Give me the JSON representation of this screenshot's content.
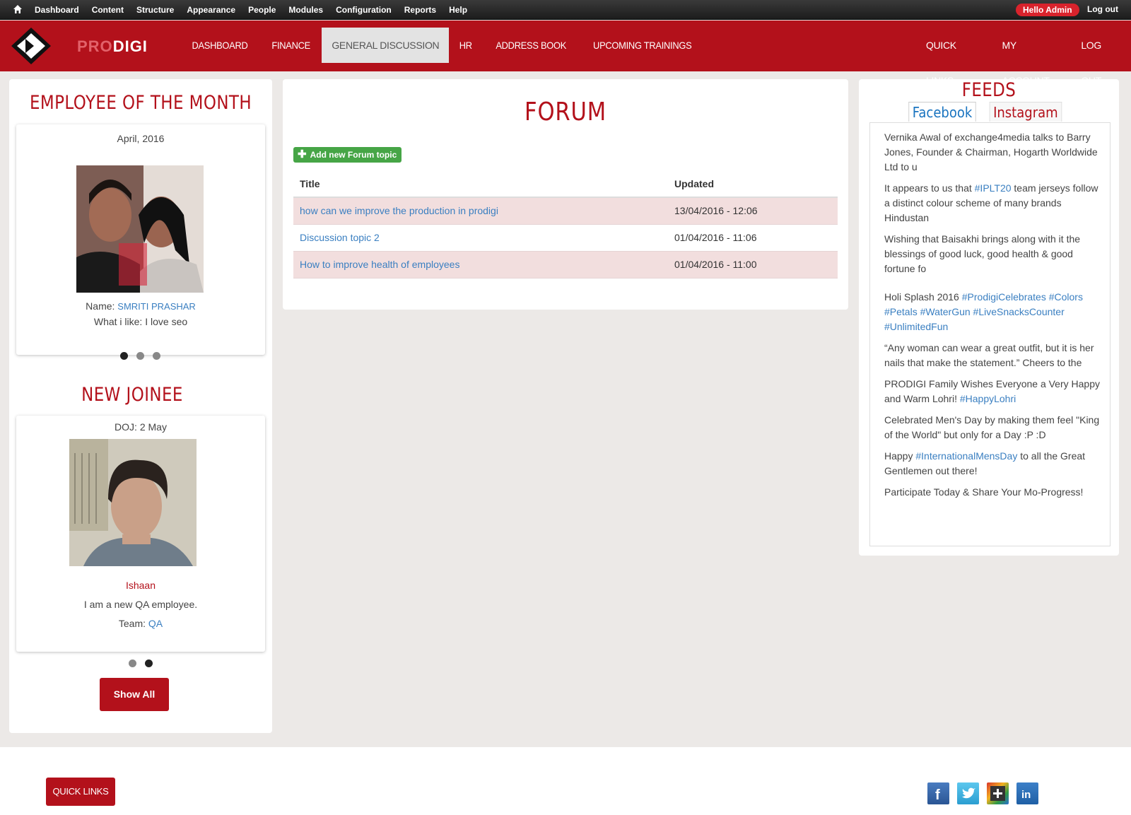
{
  "admin_bar": {
    "menu": [
      "Dashboard",
      "Content",
      "Structure",
      "Appearance",
      "People",
      "Modules",
      "Configuration",
      "Reports",
      "Help"
    ],
    "hello_prefix": "Hello ",
    "hello_user": "Admin",
    "logout": "Log out"
  },
  "brand": {
    "pro": "PRO",
    "digi": "DIGI"
  },
  "nav": {
    "items": [
      "DASHBOARD",
      "FINANCE",
      "GENERAL DISCUSSION",
      "HR",
      "ADDRESS BOOK",
      "UPCOMING TRAININGS"
    ],
    "active": "GENERAL DISCUSSION",
    "right": [
      "QUICK LINKS",
      "MY ACCOUNT",
      "LOG OUT"
    ]
  },
  "employee_of_month": {
    "title": "EMPLOYEE OF THE MONTH",
    "date": "April, 2016",
    "name_label": "Name: ",
    "name": "SMRITI PRASHAR",
    "like": "What i like: I love seo"
  },
  "new_joinee": {
    "title": "NEW JOINEE",
    "doj": "DOJ: 2 May",
    "name": "Ishaan",
    "desc": "I am a new QA employee.",
    "team_label": "Team: ",
    "team": "QA",
    "show_all": "Show All"
  },
  "forum": {
    "title": "FORUM",
    "add_button": "Add new Forum topic",
    "columns": [
      "Title",
      "Updated"
    ],
    "rows": [
      {
        "title": "how can we improve the production in prodigi",
        "updated": "13/04/2016 - 12:06"
      },
      {
        "title": "Discussion topic 2",
        "updated": "01/04/2016 - 11:06"
      },
      {
        "title": "How to improve health of employees",
        "updated": "01/04/2016 - 11:00"
      }
    ]
  },
  "feeds": {
    "title": "FEEDS",
    "tabs": [
      "Facebook",
      "Instagram"
    ],
    "items": [
      {
        "text": "Vernika Awal of exchange4media talks to Barry Jones, Founder & Chairman, Hogarth Worldwide Ltd to u"
      },
      {
        "pre": "It appears to us that ",
        "tag": "#IPLT20",
        "post": " team jerseys follow a distinct colour scheme of many brands Hindustan"
      },
      {
        "text": "Wishing that Baisakhi brings along with it the blessings of good luck, good health & good fortune fo"
      },
      {
        "pre": "Holi Splash 2016 ",
        "tag": "#ProdigiCelebrates #Colors #Petals #WaterGun #LiveSnacksCounter #UnlimitedFun",
        "post": ""
      },
      {
        "text": "“Any woman can wear a great outfit, but it is her nails that make the statement.” Cheers to the"
      },
      {
        "pre": "PRODIGI Family Wishes Everyone a Very Happy and Warm Lohri! ",
        "tag": "#HappyLohri",
        "post": ""
      },
      {
        "text": "Celebrated Men's Day by making them feel \"King of the World\" but only for a Day :P :D"
      },
      {
        "pre": "Happy ",
        "tag": "#InternationalMensDay",
        "post": " to all the Great Gentlemen out there!"
      },
      {
        "text": "Participate Today & Share Your Mo-Progress!"
      }
    ]
  },
  "footer": {
    "quick_links": "QUICK LINKS",
    "social": [
      "facebook-icon",
      "twitter-icon",
      "google-plus-icon",
      "linkedin-icon"
    ]
  },
  "colors": {
    "brand_red": "#b3111b",
    "link": "#3a7fc1",
    "row_highlight": "#f2dede",
    "green": "#46a546"
  }
}
